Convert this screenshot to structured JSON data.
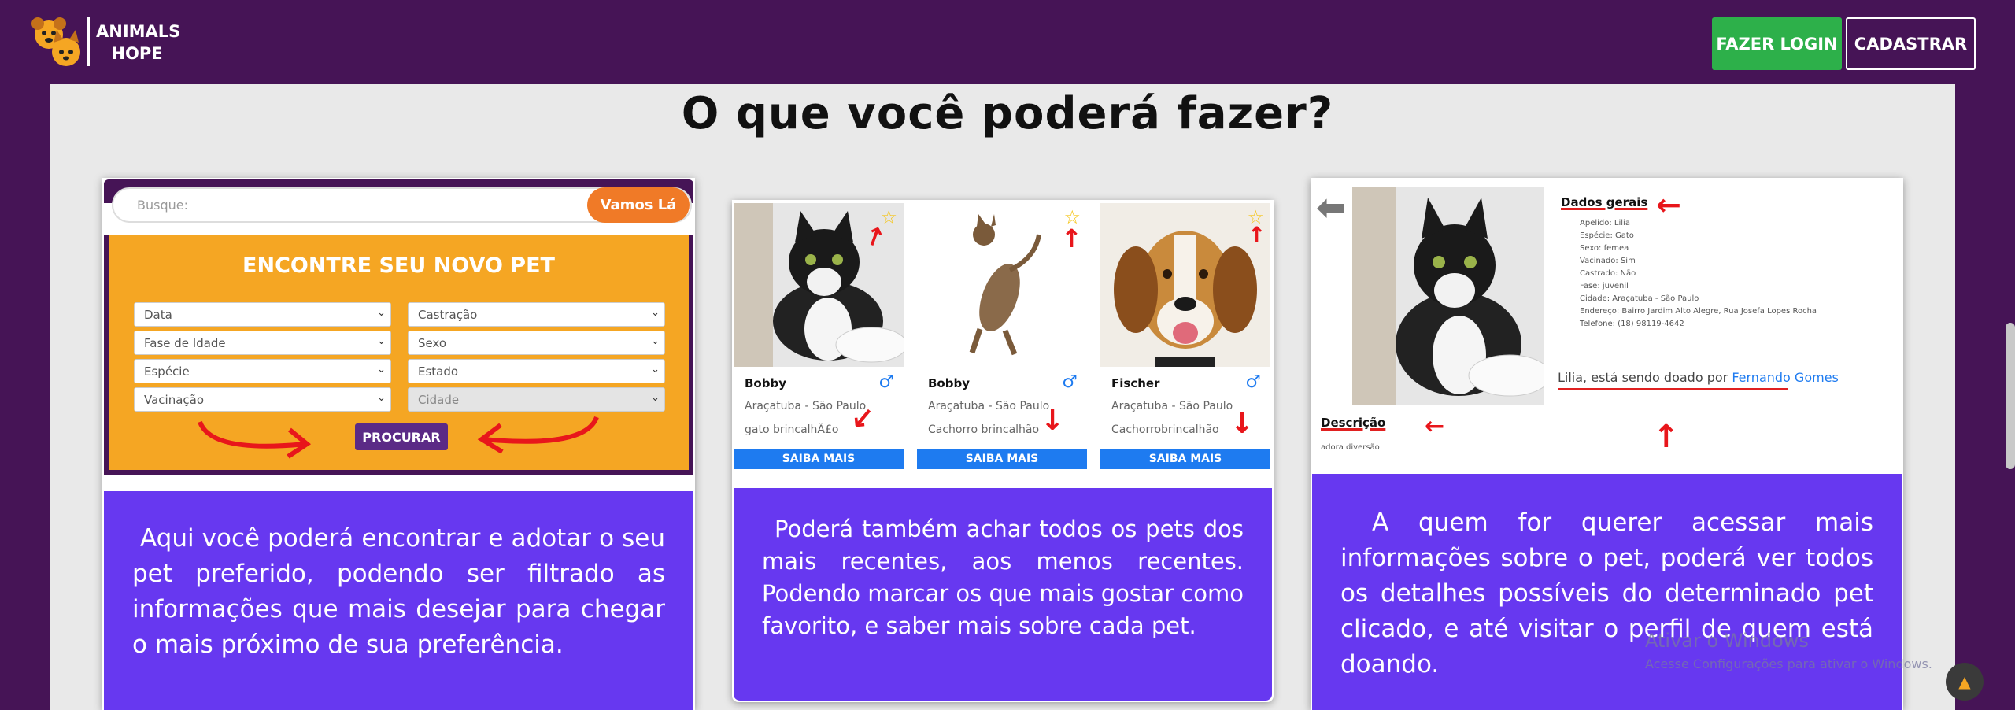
{
  "header": {
    "logo_line1": "ANIMALS",
    "logo_line2": "HOPE",
    "login_label": "FAZER LOGIN",
    "register_label": "CADASTRAR"
  },
  "section_title": "O que você poderá fazer?",
  "card1": {
    "search_placeholder": "Busque:",
    "search_button": "Vamos Lá",
    "heading": "ENCONTRE SEU NOVO PET",
    "filters": [
      "Data",
      "Castração",
      "Fase de Idade",
      "Sexo",
      "Espécie",
      "Estado",
      "Vacinação",
      "Cidade"
    ],
    "search_submit": "PROCURAR",
    "text": "Aqui você poderá encontrar e adotar o seu pet preferido, podendo ser filtrado as informações que mais desejar para chegar o mais próximo de sua preferência."
  },
  "card2": {
    "pets": [
      {
        "name": "Bobby",
        "city": "Araçatuba - São Paulo",
        "desc": "gato brincalhÃ£o",
        "button": "SAIBA MAIS"
      },
      {
        "name": "Bobby",
        "city": "Araçatuba - São Paulo",
        "desc": "Cachorro brincalhão",
        "button": "SAIBA MAIS"
      },
      {
        "name": "Fischer",
        "city": "Araçatuba - São Paulo",
        "desc": "Cachorrobrincalhão",
        "button": "SAIBA MAIS"
      }
    ],
    "text": "Poderá também achar todos os pets dos mais recentes, aos menos recentes. Podendo marcar os que mais gostar como favorito, e saber mais sobre cada pet."
  },
  "card3": {
    "details_heading": "Dados gerais",
    "details": [
      "Apelido: Lilia",
      "Espécie: Gato",
      "Sexo: femea",
      "Vacinado: Sim",
      "Castrado: Não",
      "Fase: juvenil",
      "Cidade: Araçatuba - São Paulo",
      "Endereço: Bairro Jardim Alto Alegre, Rua Josefa Lopes Rocha",
      "Telefone: (18) 98119-4642"
    ],
    "donor_prefix": "Lilia, está sendo doado por",
    "donor_name": "Fernando Gomes",
    "description_heading": "Descrição",
    "description_text": "adora diversão",
    "text": "A quem for querer acessar mais informações sobre o pet, poderá ver todos os detalhes possíveis do determinado pet clicado, e até visitar o perfil de quem está doando."
  },
  "watermark": {
    "line1": "Ativar o Windows",
    "line2": "Acesse Configurações para ativar o Windows."
  },
  "colors": {
    "header_bg": "#461456",
    "login_green": "#2db04a",
    "card_text_bg": "#6738f0",
    "orange": "#f5a623",
    "blue_button": "#1e7bf0",
    "arrow_red": "#e8161b"
  }
}
